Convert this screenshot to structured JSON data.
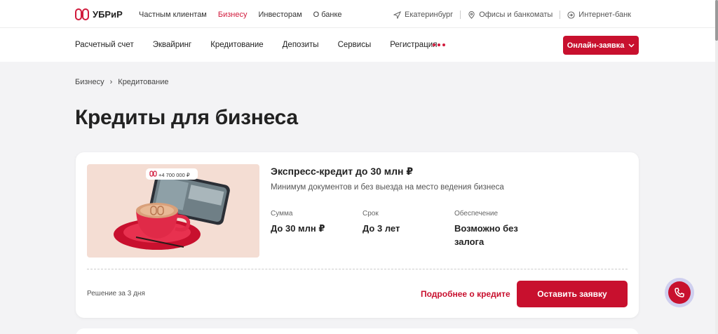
{
  "header": {
    "logo_text": "УБРиР",
    "nav": [
      {
        "label": "Частным клиентам",
        "active": false
      },
      {
        "label": "Бизнесу",
        "active": true
      },
      {
        "label": "Инвесторам",
        "active": false
      },
      {
        "label": "О банке",
        "active": false
      }
    ],
    "city": "Екатеринбург",
    "offices": "Офисы и банкоматы",
    "internet_bank": "Интернет-банк"
  },
  "mainnav": {
    "items": [
      "Расчетный счет",
      "Эквайринг",
      "Кредитование",
      "Депозиты",
      "Сервисы",
      "Регистрация"
    ],
    "online_button": "Онлайн-заявка"
  },
  "breadcrumb": [
    "Бизнесу",
    "Кредитование"
  ],
  "page_title": "Кредиты для бизнеса",
  "card": {
    "image_amount": "+4 700 000 ₽",
    "title": "Экспресс-кредит до 30 млн ₽",
    "subtitle": "Минимум документов и без выезда на место ведения бизнеса",
    "params": [
      {
        "label": "Сумма",
        "value": "До 30 млн ₽"
      },
      {
        "label": "Срок",
        "value": "До 3 лет"
      },
      {
        "label": "Обеспечение",
        "value": "Возможно без залога"
      }
    ],
    "decision": "Решение за 3 дня",
    "more_link": "Подробнее о кредите",
    "apply_button": "Оставить заявку"
  },
  "colors": {
    "accent": "#c8102e",
    "background": "#f3f3f5"
  }
}
